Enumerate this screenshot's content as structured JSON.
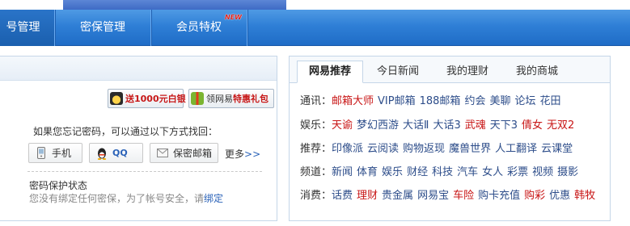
{
  "nav": {
    "items": [
      {
        "label": "号管理",
        "active": true
      },
      {
        "label": "密保管理",
        "active": false
      },
      {
        "label": "会员特权",
        "active": false
      }
    ],
    "new_badge": "NEW"
  },
  "left": {
    "promo": [
      {
        "label": "送1000元白银",
        "icon": "coin-chest-icon"
      },
      {
        "label_prefix": "领网易",
        "label_highlight": "特惠礼包",
        "icon": "gift-icon"
      }
    ],
    "forgot_text": "如果您忘记密码，可以通过以下方式找回：",
    "options": [
      {
        "label": "手机",
        "icon": "phone-icon"
      },
      {
        "label": "QQ",
        "icon": "qq-penguin-icon"
      },
      {
        "label": "保密邮箱",
        "icon": "mail-icon"
      }
    ],
    "more": "更多",
    "more_arrows": ">>",
    "status_title": "密码保护状态",
    "status_desc": "您没有绑定任何密保，为了帐号安全，请",
    "status_link": "绑定"
  },
  "right": {
    "tabs": [
      "网易推荐",
      "今日新闻",
      "我的理财",
      "我的商城"
    ],
    "rows": [
      {
        "category": "通讯：",
        "links": [
          {
            "t": "邮箱大师",
            "red": true
          },
          {
            "t": "VIP邮箱",
            "red": false
          },
          {
            "t": "188邮箱",
            "red": false
          },
          {
            "t": "约会",
            "red": false
          },
          {
            "t": "美聊",
            "red": false
          },
          {
            "t": "论坛",
            "red": false
          },
          {
            "t": "花田",
            "red": false
          }
        ]
      },
      {
        "category": "娱乐：",
        "links": [
          {
            "t": "天谕",
            "red": true
          },
          {
            "t": "梦幻西游",
            "red": false
          },
          {
            "t": "大话Ⅱ",
            "red": false
          },
          {
            "t": "大话3",
            "red": false
          },
          {
            "t": "武魂",
            "red": true
          },
          {
            "t": "天下3",
            "red": false
          },
          {
            "t": "倩女",
            "red": true
          },
          {
            "t": "无双2",
            "red": true
          }
        ]
      },
      {
        "category": "推荐：",
        "links": [
          {
            "t": "印像派",
            "red": false
          },
          {
            "t": "云阅读",
            "red": false
          },
          {
            "t": "购物返现",
            "red": false
          },
          {
            "t": "魔兽世界",
            "red": false
          },
          {
            "t": "人工翻译",
            "red": false
          },
          {
            "t": "云课堂",
            "red": false
          }
        ]
      },
      {
        "category": "频道：",
        "links": [
          {
            "t": "新闻",
            "red": false
          },
          {
            "t": "体育",
            "red": false
          },
          {
            "t": "娱乐",
            "red": false
          },
          {
            "t": "财经",
            "red": false
          },
          {
            "t": "科技",
            "red": false
          },
          {
            "t": "汽车",
            "red": false
          },
          {
            "t": "女人",
            "red": false
          },
          {
            "t": "彩票",
            "red": false
          },
          {
            "t": "视频",
            "red": false
          },
          {
            "t": "摄影",
            "red": false
          }
        ]
      },
      {
        "category": "消费：",
        "links": [
          {
            "t": "话费",
            "red": false
          },
          {
            "t": "理财",
            "red": true
          },
          {
            "t": "贵金属",
            "red": false
          },
          {
            "t": "网易宝",
            "red": false
          },
          {
            "t": "车险",
            "red": true
          },
          {
            "t": "购卡充值",
            "red": false
          },
          {
            "t": "购彩",
            "red": true
          },
          {
            "t": "优惠",
            "red": false
          },
          {
            "t": "韩牧",
            "red": true
          }
        ]
      }
    ]
  },
  "colors": {
    "nav_blue": "#2f7fd6",
    "link_blue": "#2d4d8a",
    "link_red": "#c81515"
  }
}
